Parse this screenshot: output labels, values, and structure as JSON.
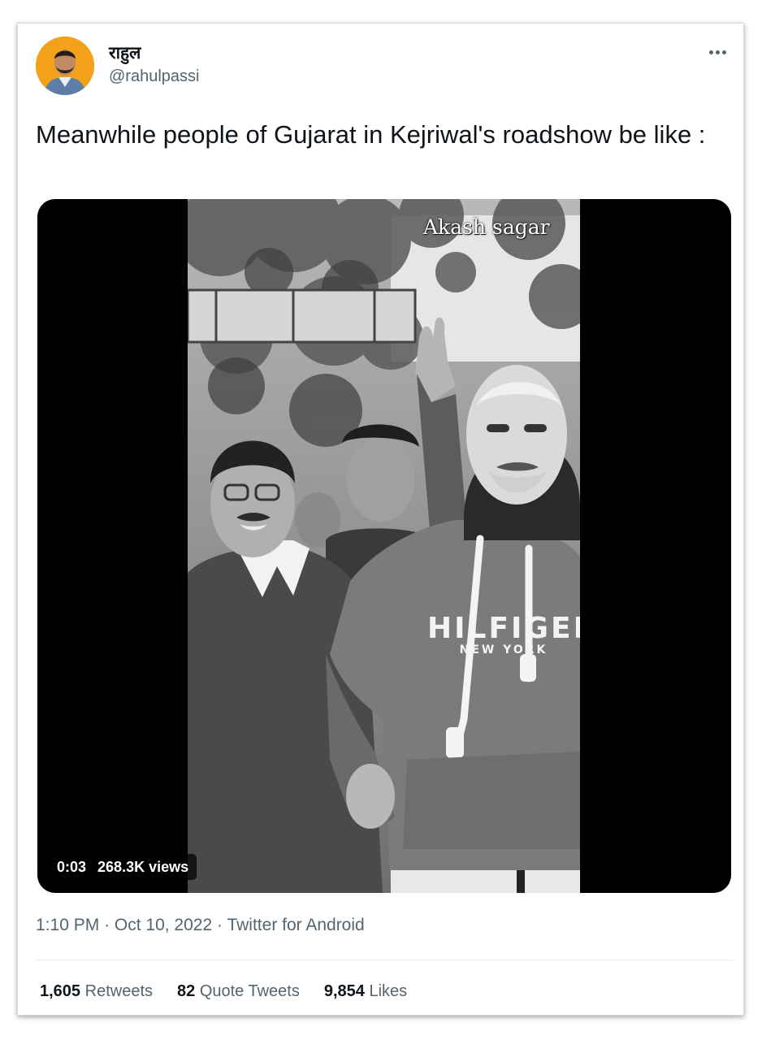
{
  "author": {
    "display_name": "राहुल",
    "handle": "@rahulpassi"
  },
  "tweet": {
    "text": "Meanwhile people of Gujarat in Kejriwal's roadshow be like :"
  },
  "video": {
    "watermark": "Akash sagar",
    "duration": "0:03",
    "views": "268.3K views",
    "hoodie_text": "HILFIGER",
    "hoodie_subtext": "NEW YORK"
  },
  "meta": {
    "time": "1:10 PM",
    "date": "Oct 10, 2022",
    "source": "Twitter for Android",
    "separator": "·"
  },
  "stats": {
    "retweets_count": "1,605",
    "retweets_label": "Retweets",
    "quotes_count": "82",
    "quotes_label": "Quote Tweets",
    "likes_count": "9,854",
    "likes_label": "Likes"
  },
  "colors": {
    "text_primary": "#0f1419",
    "text_secondary": "#536471",
    "avatar_bg": "#f4a11a",
    "media_bg": "#000000"
  },
  "icons": {
    "more": "more-dots-icon"
  }
}
